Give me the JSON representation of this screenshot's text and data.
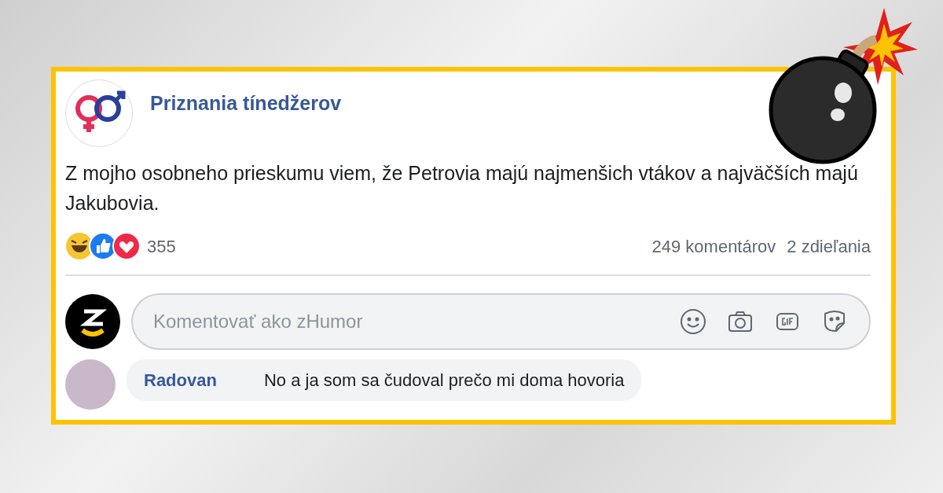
{
  "post": {
    "page_name": "Priznania tínedžerov",
    "text": "Z mojho osobneho prieskumu viem, že Petrovia majú najmenšich vtákov a najväčších majú Jakubovia.",
    "reactions_count": "355",
    "comments_count": "249 komentárov",
    "shares_count": "2 zdieľania"
  },
  "comment_field": {
    "placeholder": "Komentovať ako zHumor"
  },
  "comments": [
    {
      "author": "Radovan",
      "text": "No a ja som sa čudoval prečo mi doma hovoria"
    }
  ]
}
